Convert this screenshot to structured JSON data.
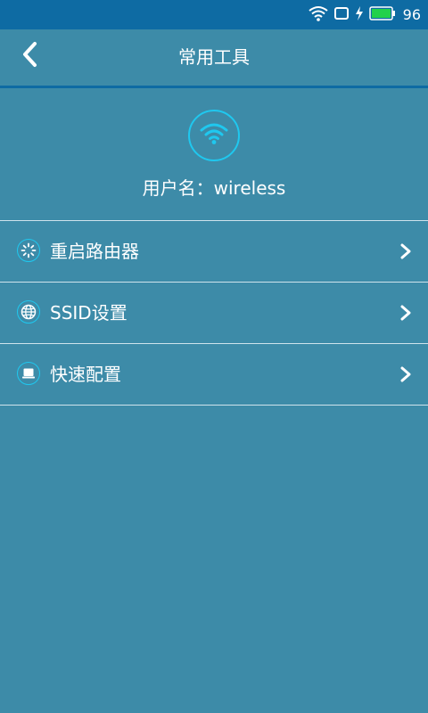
{
  "status_bar": {
    "battery_level": "96",
    "icons": [
      "wifi-icon",
      "screen-icon",
      "charging-icon",
      "battery-icon"
    ],
    "battery_color": "#22d14a"
  },
  "header": {
    "title": "常用工具",
    "back_icon": "chevron-left-icon"
  },
  "profile": {
    "avatar_icon": "wifi-icon",
    "username_label": "用户名：",
    "username": "wireless"
  },
  "menu": {
    "items": [
      {
        "label": "重启路由器",
        "icon": "restart-spinner-icon"
      },
      {
        "label": "SSID设置",
        "icon": "globe-icon"
      },
      {
        "label": "快速配置",
        "icon": "laptop-icon"
      }
    ]
  },
  "colors": {
    "background": "#3d8ba8",
    "status_bar": "#0e6ba3",
    "accent": "#1fc8ef"
  }
}
